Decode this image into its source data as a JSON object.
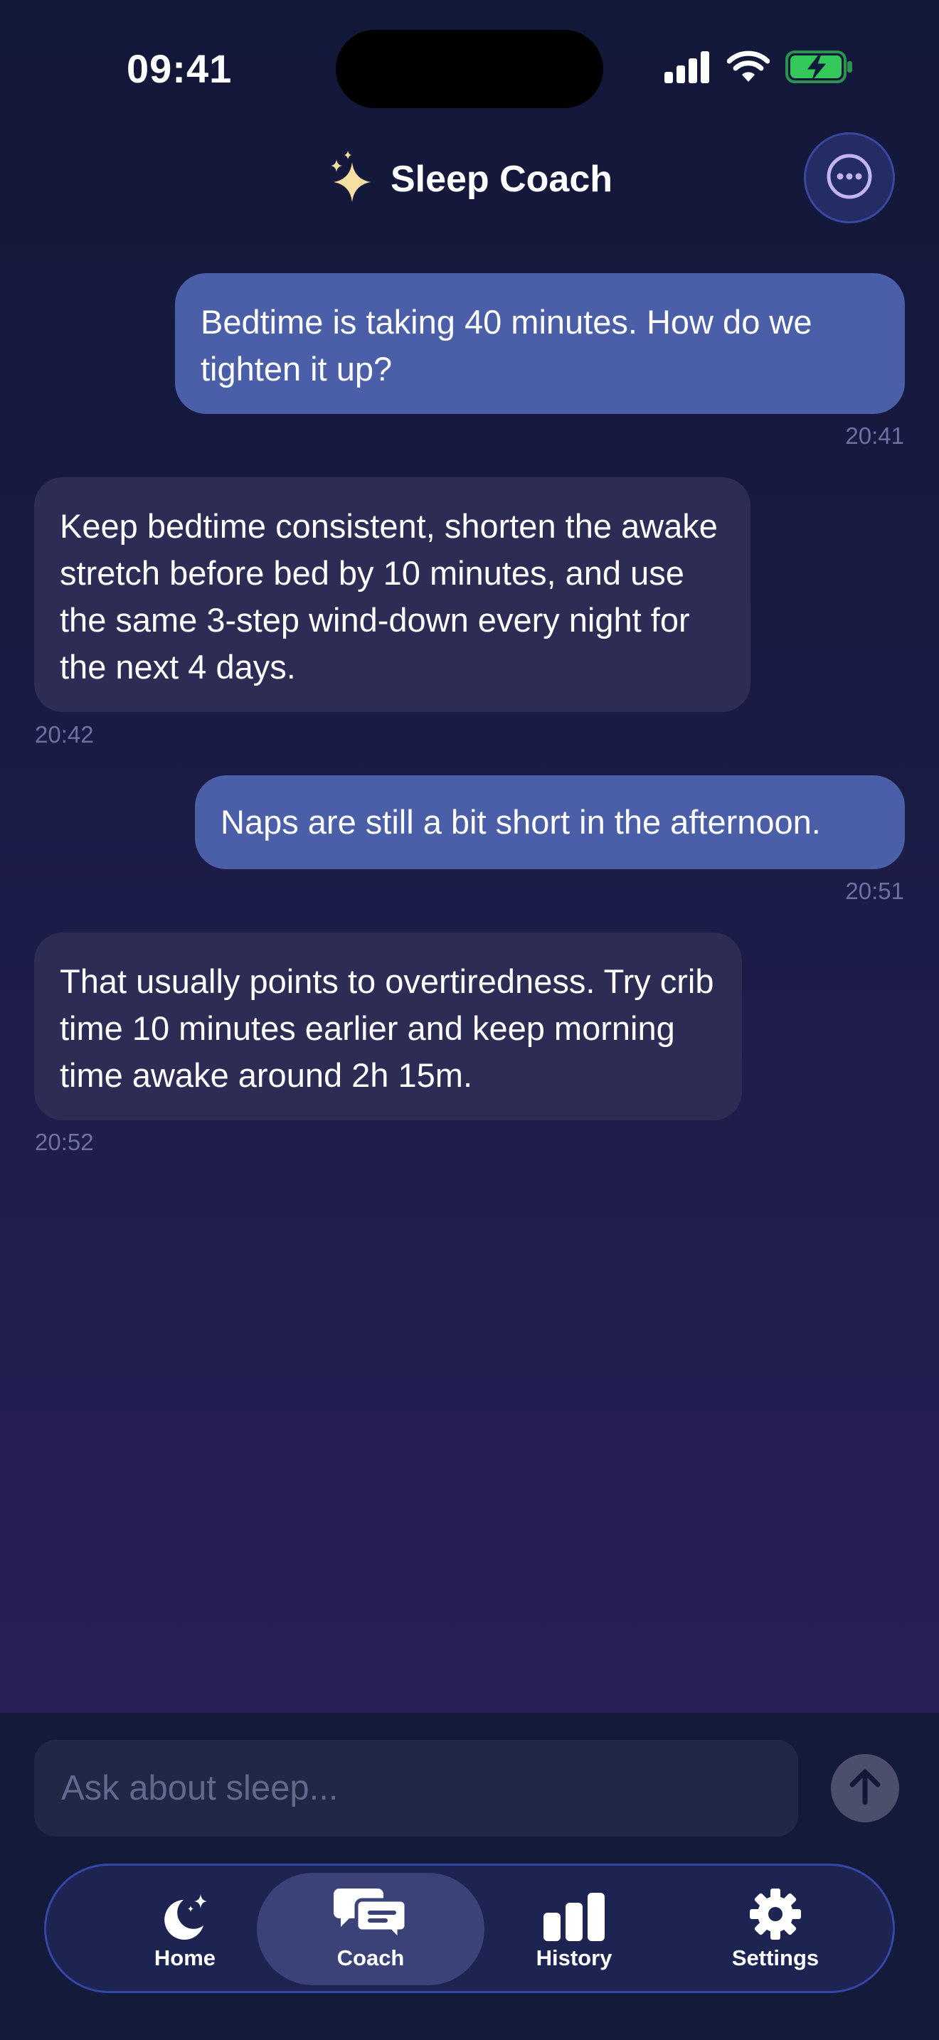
{
  "status_bar": {
    "time": "09:41"
  },
  "header": {
    "title": "Sleep Coach",
    "title_icon": "sparkles-icon",
    "more_icon": "ellipsis-circle-icon"
  },
  "messages": [
    {
      "role": "user",
      "text": "Bedtime is taking 40 minutes. How do we tighten it up?",
      "time": "20:41"
    },
    {
      "role": "coach",
      "text": "Keep bedtime consistent, shorten the awake stretch before bed by 10 minutes, and use the same 3-step wind-down every night for the next 4 days.",
      "time": "20:42"
    },
    {
      "role": "user",
      "text": "Naps are still a bit short in the afternoon.",
      "time": "20:51"
    },
    {
      "role": "coach",
      "text": "That usually points to overtiredness. Try crib time 10 minutes earlier and keep morning time awake around 2h 15m.",
      "time": "20:52"
    }
  ],
  "composer": {
    "placeholder": "Ask about sleep...",
    "value": "",
    "send_icon": "arrow-up-icon"
  },
  "tabs": [
    {
      "label": "Home",
      "icon": "moon-stars-icon",
      "active": false
    },
    {
      "label": "Coach",
      "icon": "chat-bubbles-icon",
      "active": true
    },
    {
      "label": "History",
      "icon": "bar-chart-icon",
      "active": false
    },
    {
      "label": "Settings",
      "icon": "gear-icon",
      "active": false
    }
  ],
  "colors": {
    "user_bubble": "#4a5fa8",
    "coach_bubble": "#2d2c55",
    "accent_sparkle": "#f6dfa3",
    "battery_green": "#34c759",
    "active_tab": "#3a4277"
  }
}
